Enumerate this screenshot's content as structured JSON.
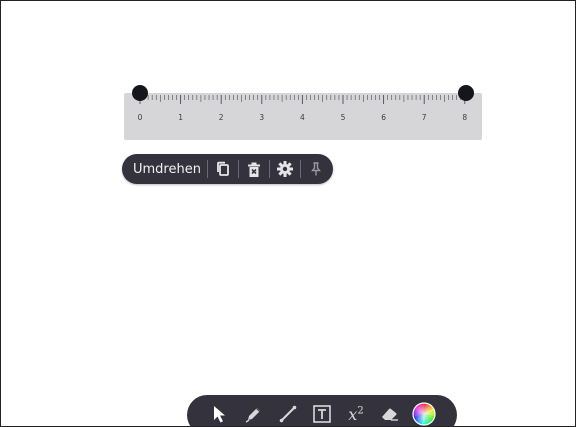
{
  "ruler": {
    "tick_labels": [
      "0",
      "1",
      "2",
      "3",
      "4",
      "5",
      "6",
      "7",
      "8"
    ]
  },
  "context_toolbar": {
    "flip_label": "Umdrehen",
    "icons": [
      "copy-icon",
      "delete-icon",
      "settings-icon",
      "pin-icon"
    ]
  },
  "main_toolbar": {
    "tools": [
      "select-icon",
      "pen-icon",
      "line-icon",
      "text-icon",
      "math-icon",
      "eraser-icon",
      "color-picker-icon"
    ],
    "math_label": "x",
    "math_superscript": "2"
  },
  "colors": {
    "toolbar_bg": "#34333d",
    "ruler_bg": "#d6d6d9",
    "handle": "#15151c",
    "icon": "#e6e6ea"
  }
}
